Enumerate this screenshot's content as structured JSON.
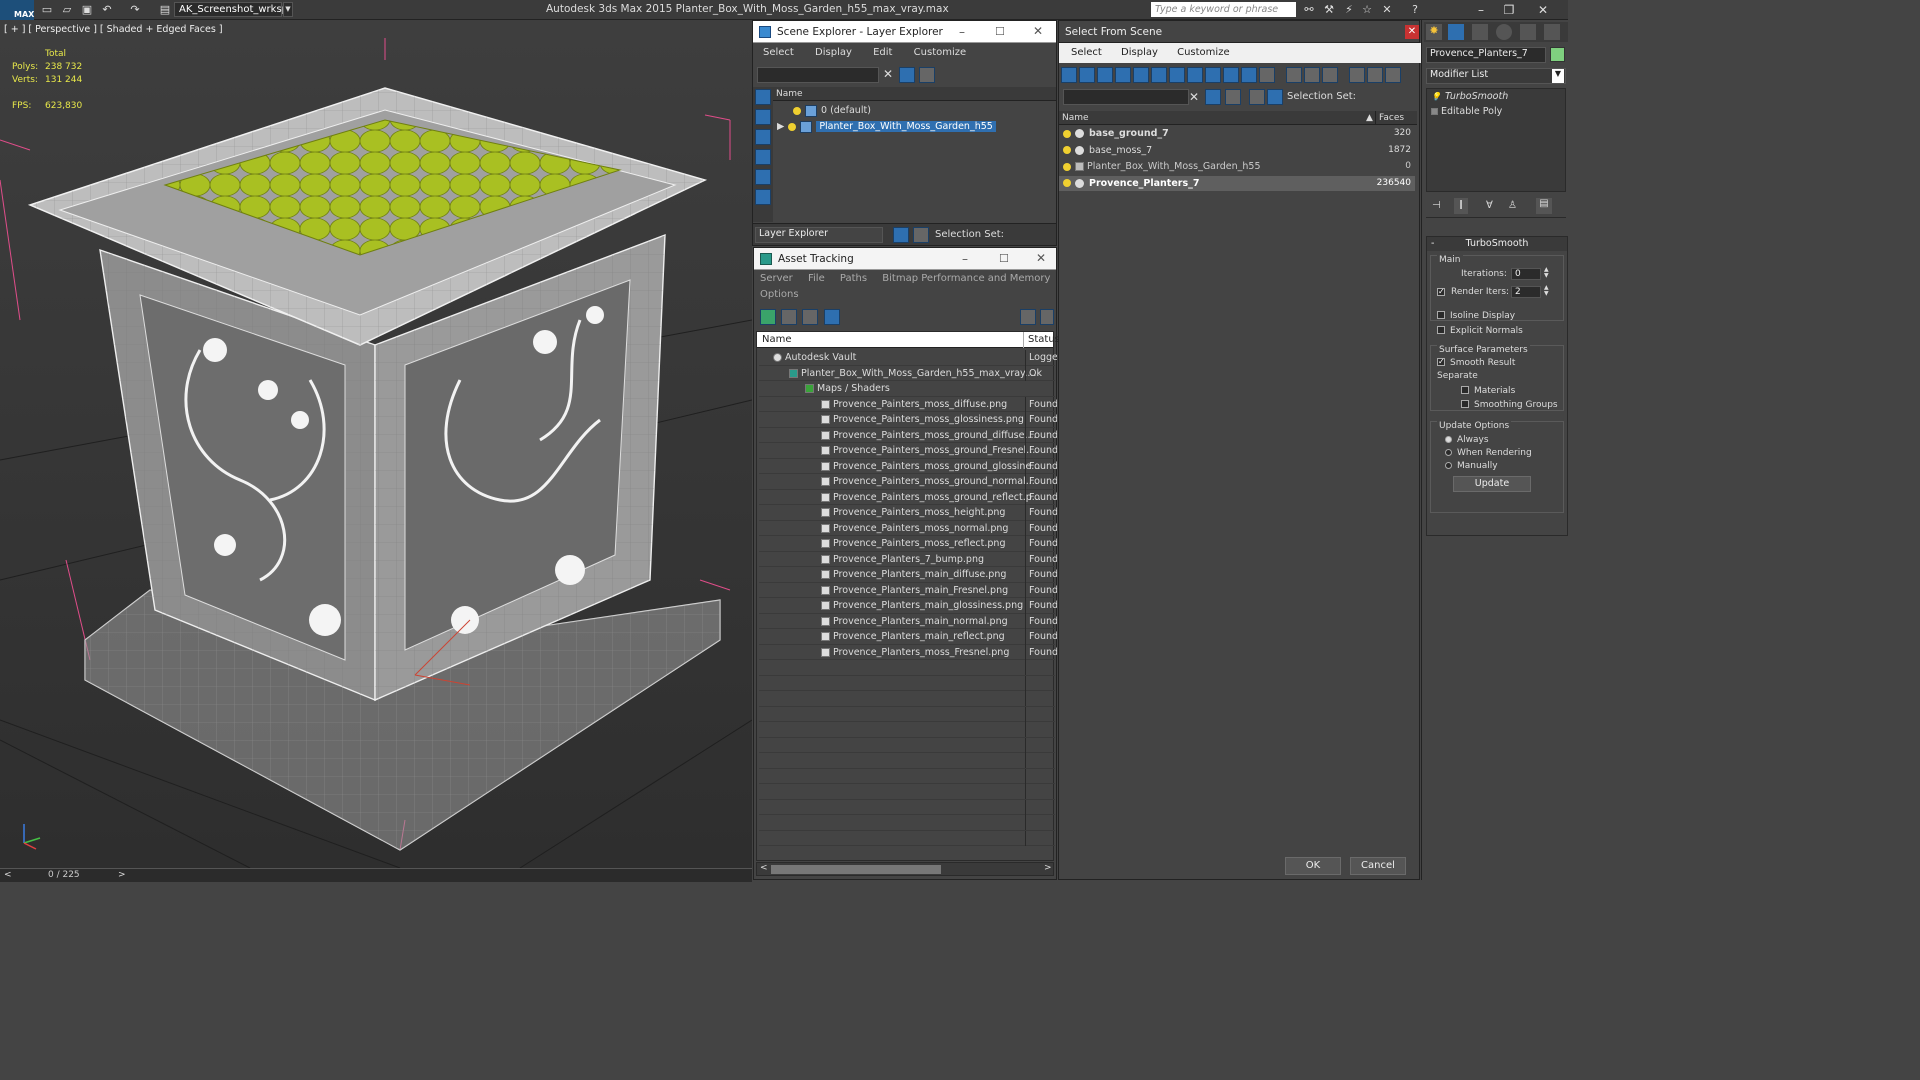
{
  "app": {
    "workspace": "AK_Screenshot_wrksp",
    "title": "Autodesk 3ds Max  2015     Planter_Box_With_Moss_Garden_h55_max_vray.max",
    "search_placeholder": "Type a keyword or phrase"
  },
  "viewport": {
    "label": "[ + ] [ Perspective ] [ Shaded + Edged Faces ]",
    "stats": {
      "total_label": "Total",
      "polys_label": "Polys:",
      "polys": "238 732",
      "verts_label": "Verts:",
      "verts": "131 244",
      "fps_label": "FPS:",
      "fps": "623,830"
    },
    "frame": "0 / 225",
    "prev": "<",
    "next": ">"
  },
  "scene_explorer": {
    "title": "Scene Explorer - Layer Explorer",
    "menu": [
      "Select",
      "Display",
      "Edit",
      "Customize"
    ],
    "column": "Name",
    "layers": [
      {
        "name": "0 (default)",
        "selected": false
      },
      {
        "name": "Planter_Box_With_Moss_Garden_h55",
        "selected": true
      }
    ],
    "footer_dropdown": "Layer Explorer",
    "selection_set_label": "Selection Set:"
  },
  "asset_tracking": {
    "title": "Asset Tracking",
    "menu": [
      "Server",
      "File",
      "Paths",
      "Bitmap Performance and Memory"
    ],
    "menu2": [
      "Options"
    ],
    "columns": {
      "name": "Name",
      "status": "Status"
    },
    "vault": {
      "name": "Autodesk Vault",
      "status": "Logged"
    },
    "file": {
      "name": "Planter_Box_With_Moss_Garden_h55_max_vray....",
      "status": "Ok"
    },
    "group": {
      "name": "Maps / Shaders",
      "status": ""
    },
    "maps": [
      {
        "name": "Provence_Painters_moss_diffuse.png",
        "status": "Found"
      },
      {
        "name": "Provence_Painters_moss_glossiness.png",
        "status": "Found"
      },
      {
        "name": "Provence_Painters_moss_ground_diffuse....",
        "status": "Found"
      },
      {
        "name": "Provence_Painters_moss_ground_Fresnel....",
        "status": "Found"
      },
      {
        "name": "Provence_Painters_moss_ground_glossine...",
        "status": "Found"
      },
      {
        "name": "Provence_Painters_moss_ground_normal....",
        "status": "Found"
      },
      {
        "name": "Provence_Painters_moss_ground_reflect.p...",
        "status": "Found"
      },
      {
        "name": "Provence_Painters_moss_height.png",
        "status": "Found"
      },
      {
        "name": "Provence_Painters_moss_normal.png",
        "status": "Found"
      },
      {
        "name": "Provence_Painters_moss_reflect.png",
        "status": "Found"
      },
      {
        "name": "Provence_Planters_7_bump.png",
        "status": "Found"
      },
      {
        "name": "Provence_Planters_main_diffuse.png",
        "status": "Found"
      },
      {
        "name": "Provence_Planters_main_Fresnel.png",
        "status": "Found"
      },
      {
        "name": "Provence_Planters_main_glossiness.png",
        "status": "Found"
      },
      {
        "name": "Provence_Planters_main_normal.png",
        "status": "Found"
      },
      {
        "name": "Provence_Planters_main_reflect.png",
        "status": "Found"
      },
      {
        "name": "Provence_Planters_moss_Fresnel.png",
        "status": "Found"
      }
    ]
  },
  "select_from_scene": {
    "title": "Select From Scene",
    "menu": [
      "Select",
      "Display",
      "Customize"
    ],
    "selection_set_label": "Selection Set:",
    "columns": {
      "name": "Name",
      "faces": "Faces"
    },
    "objects": [
      {
        "name": "base_ground_7",
        "faces": "320",
        "bold": true,
        "selected": false
      },
      {
        "name": "base_moss_7",
        "faces": "1872",
        "bold": false,
        "selected": false
      },
      {
        "name": "Planter_Box_With_Moss_Garden_h55",
        "faces": "0",
        "bold": false,
        "selected": false
      },
      {
        "name": "Provence_Planters_7",
        "faces": "236540",
        "bold": true,
        "selected": true
      }
    ],
    "ok": "OK",
    "cancel": "Cancel"
  },
  "modify_panel": {
    "object_name": "Provence_Planters_7",
    "modifier_list": "Modifier List",
    "stack": [
      "TurboSmooth",
      "Editable Poly"
    ],
    "rollout": "TurboSmooth",
    "main_label": "Main",
    "iterations_label": "Iterations:",
    "iterations": "0",
    "render_iters_label": "Render Iters:",
    "render_iters": "2",
    "isoline": "Isoline Display",
    "explicit_normals": "Explicit Normals",
    "surface_params": "Surface Parameters",
    "smooth_result": "Smooth Result",
    "separate": "Separate",
    "materials": "Materials",
    "smoothing_groups": "Smoothing Groups",
    "update_options": "Update Options",
    "always": "Always",
    "when_rendering": "When Rendering",
    "manually": "Manually",
    "update_button": "Update"
  }
}
